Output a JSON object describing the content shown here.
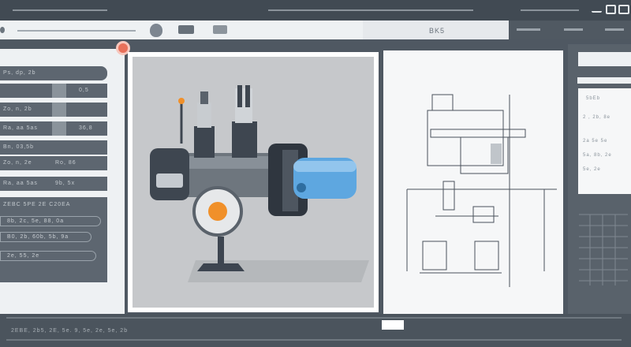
{
  "toolbar": {
    "badge_text": "BK5",
    "right_text": "BK5 ↑"
  },
  "sidebar": {
    "items": [
      {
        "label": "Ps, dp, 2b",
        "value": "0,5"
      },
      {
        "label": "Zo, n, 2b",
        "value": "36,8"
      },
      {
        "label": "Ra, aa 5as",
        "value": ""
      },
      {
        "label": "Bn, 03,5b",
        "value": "Ro, 86"
      },
      {
        "label": "Zo, n, 2e",
        "value": "9b, 5x"
      }
    ],
    "block_title": "ZEBC 5PE 2E C20EA",
    "pills": [
      {
        "label": "8b, 2c, 5e, 88, 0a"
      },
      {
        "label": "B0, 2b, 60b, 5b, 9a"
      },
      {
        "label": "2e, 55, 2e"
      }
    ]
  },
  "right_panel": {
    "card_title": "5bEb",
    "rows": [
      "2 , 2b, 8e",
      "2a 5e 5e",
      "5a, 8b, 2e",
      "5e, 2e"
    ]
  },
  "bottom": {
    "status": "2EBE, 2b5, 2E, 5e. 9, 5e, 2e, 5e, 2b"
  },
  "colors": {
    "accent_notification": "#e8705a",
    "nozzle_blue": "#5ea7e0",
    "knob_orange": "#f0902a"
  }
}
